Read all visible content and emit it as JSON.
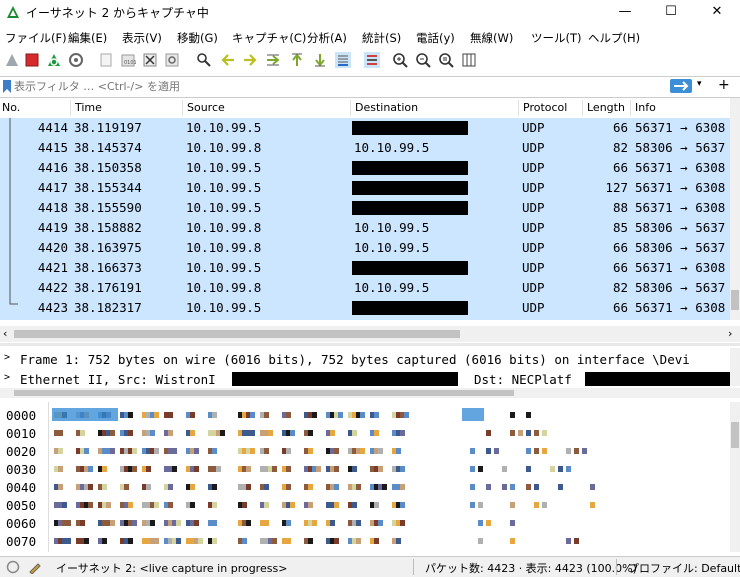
{
  "window": {
    "title": "イーサネット 2 からキャプチャ中"
  },
  "menu": [
    "ファイル(F)",
    "編集(E)",
    "表示(V)",
    "移動(G)",
    "キャプチャ(C)",
    "分析(A)",
    "統計(S)",
    "電話(y)",
    "無線(W)",
    "ツール(T)",
    "ヘルプ(H)"
  ],
  "filter": {
    "placeholder": "表示フィルタ … <Ctrl-/> を適用"
  },
  "columns": [
    "No.",
    "Time",
    "Source",
    "Destination",
    "Protocol",
    "Length",
    "Info"
  ],
  "packets": [
    {
      "no": "4414",
      "time": "38.119197",
      "src": "10.10.99.5",
      "dst": "",
      "proto": "UDP",
      "len": "66",
      "info": "56371 → 6308"
    },
    {
      "no": "4415",
      "time": "38.145374",
      "src": "10.10.99.8",
      "dst": "10.10.99.5",
      "proto": "UDP",
      "len": "82",
      "info": "58306 → 5637"
    },
    {
      "no": "4416",
      "time": "38.150358",
      "src": "10.10.99.5",
      "dst": "",
      "proto": "UDP",
      "len": "66",
      "info": "56371 → 6308"
    },
    {
      "no": "4417",
      "time": "38.155344",
      "src": "10.10.99.5",
      "dst": "",
      "proto": "UDP",
      "len": "127",
      "info": "56371 → 6308"
    },
    {
      "no": "4418",
      "time": "38.155590",
      "src": "10.10.99.5",
      "dst": "",
      "proto": "UDP",
      "len": "88",
      "info": "56371 → 6308"
    },
    {
      "no": "4419",
      "time": "38.158882",
      "src": "10.10.99.8",
      "dst": "10.10.99.5",
      "proto": "UDP",
      "len": "85",
      "info": "58306 → 5637"
    },
    {
      "no": "4420",
      "time": "38.163975",
      "src": "10.10.99.8",
      "dst": "10.10.99.5",
      "proto": "UDP",
      "len": "66",
      "info": "58306 → 5637"
    },
    {
      "no": "4421",
      "time": "38.166373",
      "src": "10.10.99.5",
      "dst": "",
      "proto": "UDP",
      "len": "66",
      "info": "56371 → 6308"
    },
    {
      "no": "4422",
      "time": "38.176191",
      "src": "10.10.99.8",
      "dst": "10.10.99.5",
      "proto": "UDP",
      "len": "82",
      "info": "58306 → 5637"
    },
    {
      "no": "4423",
      "time": "38.182317",
      "src": "10.10.99.5",
      "dst": "",
      "proto": "UDP",
      "len": "66",
      "info": "56371 → 6308"
    }
  ],
  "details": [
    "Frame 1: 752 bytes on wire (6016 bits), 752 bytes captured (6016 bits) on interface \\Devi",
    "Ethernet II, Src: WistronI",
    "Dst: NECPlatf"
  ],
  "bytes_offsets": [
    "0000",
    "0010",
    "0020",
    "0030",
    "0040",
    "0050",
    "0060",
    "0070"
  ],
  "status": {
    "interface": "イーサネット 2: <live capture in progress>",
    "packets": "パケット数: 4423 · 表示: 4423 (100.0%)",
    "profile": "プロファイル: Default"
  },
  "colors": {
    "selected_row": "#cce6ff",
    "accent": "#3c8fd6"
  }
}
